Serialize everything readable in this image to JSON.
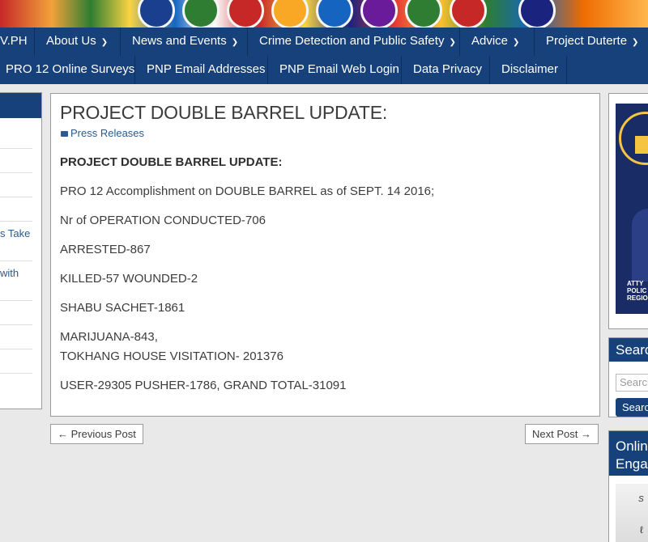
{
  "nav_primary": [
    {
      "label": "V.PH",
      "has_dropdown": false
    },
    {
      "label": "About Us",
      "has_dropdown": true
    },
    {
      "label": "News and Events",
      "has_dropdown": true
    },
    {
      "label": "Crime Detection and Public Safety",
      "has_dropdown": true
    },
    {
      "label": "Advice",
      "has_dropdown": true
    },
    {
      "label": "Project Duterte",
      "has_dropdown": true
    }
  ],
  "nav_secondary": [
    {
      "label": "PRO 12 Online Surveys"
    },
    {
      "label": "PNP Email Addresses"
    },
    {
      "label": "PNP Email Web Login"
    },
    {
      "label": "Data Privacy"
    },
    {
      "label": "Disclaimer"
    }
  ],
  "sidebar_left": {
    "snippets": [
      "s Take",
      "with"
    ]
  },
  "article": {
    "title": "PROJECT DOUBLE BARREL UPDATE:",
    "category": "Press Releases",
    "category_icon": "folder-icon",
    "heading": "PROJECT DOUBLE BARREL UPDATE:",
    "paragraphs": [
      "PRO 12 Accomplishment on DOUBLE BARREL as of SEPT. 14 2016;",
      "Nr of OPERATION CONDUCTED-706",
      "ARRESTED-867",
      "KILLED-57 WOUNDED-2",
      "SHABU SACHET-1861",
      "MARIJUANA-843,",
      "TOKHANG HOUSE VISITATION- 201376",
      "USER-29305 PUSHER-1786, GRAND TOTAL-31091"
    ]
  },
  "post_nav": {
    "previous": "← Previous Post",
    "next": "Next Post →"
  },
  "sidebar_right": {
    "poster_text": [
      "ATTY",
      "POLIC",
      "REGIO"
    ],
    "search_title": "Search",
    "search_placeholder": "Search",
    "search_button": "Search",
    "online_title_1": "Online",
    "online_title_2": "Engag"
  },
  "colors": {
    "nav_bg": "#16417a",
    "link": "#2a5a8f",
    "page_bg": "#e9e9e9"
  }
}
